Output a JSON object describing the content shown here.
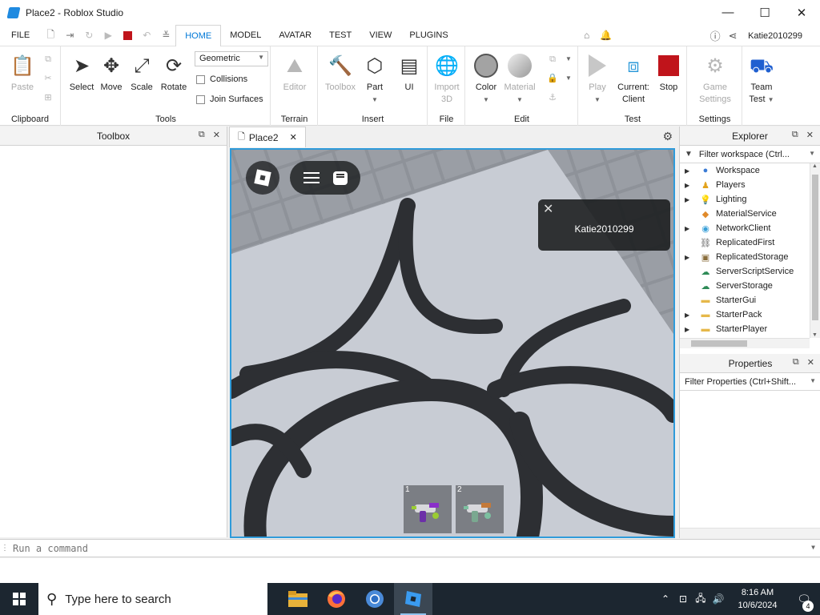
{
  "window": {
    "title": "Place2 - Roblox Studio",
    "minimize": "—",
    "maximize": "☐",
    "close": "✕"
  },
  "menu": {
    "file": "FILE",
    "tabs": [
      "HOME",
      "MODEL",
      "AVATAR",
      "TEST",
      "VIEW",
      "PLUGINS"
    ],
    "active_tab": "HOME",
    "user": "Katie2010299"
  },
  "ribbon": {
    "clipboard": {
      "label": "Clipboard",
      "paste": "Paste"
    },
    "tools": {
      "label": "Tools",
      "select": "Select",
      "move": "Move",
      "scale": "Scale",
      "rotate": "Rotate",
      "mode": "Geometric",
      "collisions": "Collisions",
      "join_surfaces": "Join Surfaces"
    },
    "terrain": {
      "label": "Terrain",
      "editor": "Editor"
    },
    "insert": {
      "label": "Insert",
      "toolbox": "Toolbox",
      "part": "Part",
      "ui": "UI"
    },
    "file": {
      "label": "File",
      "import_line1": "Import",
      "import_line2": "3D"
    },
    "edit": {
      "label": "Edit",
      "color": "Color",
      "material": "Material"
    },
    "test": {
      "label": "Test",
      "play": "Play",
      "current_line1": "Current:",
      "current_line2": "Client",
      "stop": "Stop"
    },
    "settings": {
      "label": "Settings",
      "game_line1": "Game",
      "game_line2": "Settings"
    },
    "team": {
      "line1": "Team",
      "line2": "Test"
    }
  },
  "toolbox": {
    "title": "Toolbox"
  },
  "document": {
    "tab": "Place2"
  },
  "viewport": {
    "player_name": "Katie2010299",
    "hotbar": [
      {
        "num": "1"
      },
      {
        "num": "2"
      }
    ]
  },
  "explorer": {
    "title": "Explorer",
    "filter": "Filter workspace (Ctrl...",
    "items": [
      {
        "name": "Workspace",
        "expandable": true,
        "icon": "globe-icon",
        "color": "#3a7bd5"
      },
      {
        "name": "Players",
        "expandable": true,
        "icon": "players-icon",
        "color": "#e2a21a"
      },
      {
        "name": "Lighting",
        "expandable": true,
        "icon": "lightbulb-icon",
        "color": "#f2c230"
      },
      {
        "name": "MaterialService",
        "expandable": false,
        "icon": "material-icon",
        "color": "#e08a2a"
      },
      {
        "name": "NetworkClient",
        "expandable": true,
        "icon": "network-icon",
        "color": "#3aa0d8"
      },
      {
        "name": "ReplicatedFirst",
        "expandable": false,
        "icon": "replicated-first-icon",
        "color": "#555555"
      },
      {
        "name": "ReplicatedStorage",
        "expandable": true,
        "icon": "storage-icon",
        "color": "#8a6d3b"
      },
      {
        "name": "ServerScriptService",
        "expandable": false,
        "icon": "script-service-icon",
        "color": "#2e8b57"
      },
      {
        "name": "ServerStorage",
        "expandable": false,
        "icon": "server-storage-icon",
        "color": "#2e8b57"
      },
      {
        "name": "StarterGui",
        "expandable": false,
        "icon": "folder-icon",
        "color": "#e6b84a"
      },
      {
        "name": "StarterPack",
        "expandable": true,
        "icon": "folder-icon",
        "color": "#e6b84a"
      },
      {
        "name": "StarterPlayer",
        "expandable": true,
        "icon": "folder-icon",
        "color": "#e6b84a"
      }
    ]
  },
  "properties": {
    "title": "Properties",
    "filter": "Filter Properties (Ctrl+Shift..."
  },
  "command": {
    "placeholder": "Run a command"
  },
  "taskbar": {
    "search_placeholder": "Type here to search",
    "time": "8:16 AM",
    "date": "10/6/2024",
    "notifications": "4"
  },
  "colors": {
    "accent": "#0078d7",
    "stop_red": "#c0141b",
    "viewport_border": "#2f9bda"
  }
}
